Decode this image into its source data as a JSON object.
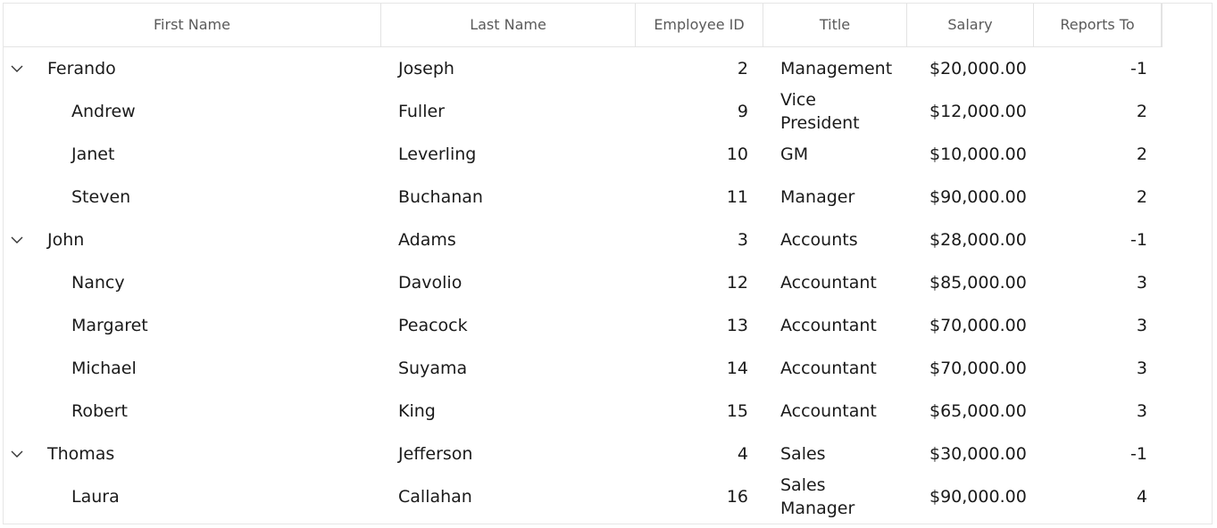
{
  "columns": [
    "First Name",
    "Last Name",
    "Employee ID",
    "Title",
    "Salary",
    "Reports To"
  ],
  "rows": [
    {
      "first": "Ferando",
      "last": "Joseph",
      "id": "2",
      "title": "Management",
      "salary": "$20,000.00",
      "reports": "-1",
      "level": 0,
      "expanded": true
    },
    {
      "first": "Andrew",
      "last": "Fuller",
      "id": "9",
      "title": "Vice\nPresident",
      "salary": "$12,000.00",
      "reports": "2",
      "level": 1
    },
    {
      "first": "Janet",
      "last": "Leverling",
      "id": "10",
      "title": "GM",
      "salary": "$10,000.00",
      "reports": "2",
      "level": 1
    },
    {
      "first": "Steven",
      "last": "Buchanan",
      "id": "11",
      "title": "Manager",
      "salary": "$90,000.00",
      "reports": "2",
      "level": 1
    },
    {
      "first": "John",
      "last": "Adams",
      "id": "3",
      "title": "Accounts",
      "salary": "$28,000.00",
      "reports": "-1",
      "level": 0,
      "expanded": true
    },
    {
      "first": "Nancy",
      "last": "Davolio",
      "id": "12",
      "title": "Accountant",
      "salary": "$85,000.00",
      "reports": "3",
      "level": 1
    },
    {
      "first": "Margaret",
      "last": "Peacock",
      "id": "13",
      "title": "Accountant",
      "salary": "$70,000.00",
      "reports": "3",
      "level": 1
    },
    {
      "first": "Michael",
      "last": "Suyama",
      "id": "14",
      "title": "Accountant",
      "salary": "$70,000.00",
      "reports": "3",
      "level": 1
    },
    {
      "first": "Robert",
      "last": "King",
      "id": "15",
      "title": "Accountant",
      "salary": "$65,000.00",
      "reports": "3",
      "level": 1
    },
    {
      "first": "Thomas",
      "last": "Jefferson",
      "id": "4",
      "title": "Sales",
      "salary": "$30,000.00",
      "reports": "-1",
      "level": 0,
      "expanded": true
    },
    {
      "first": "Laura",
      "last": "Callahan",
      "id": "16",
      "title": "Sales\nManager",
      "salary": "$90,000.00",
      "reports": "4",
      "level": 1
    }
  ],
  "icons": {
    "expander": "chevron-down-icon"
  },
  "colors": {
    "border": "#e3e3e3",
    "header_text": "#5a5a5a",
    "cell_text": "#1a1a1a"
  }
}
